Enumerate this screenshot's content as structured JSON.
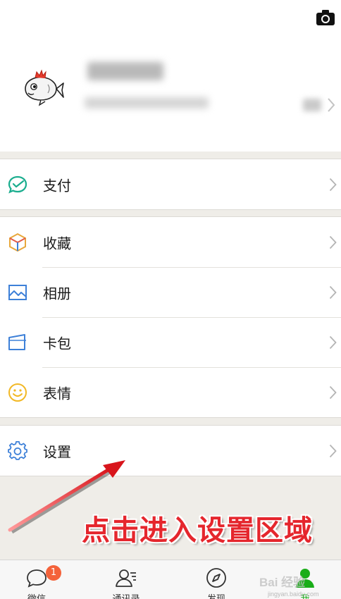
{
  "profile": {
    "camera_icon": "camera-icon",
    "avatar_icon": "fish-avatar"
  },
  "groups": [
    {
      "items": [
        {
          "label": "支付",
          "icon": "wallet-check-icon",
          "color": "#1aad8e"
        }
      ]
    },
    {
      "items": [
        {
          "label": "收藏",
          "icon": "cube-icon",
          "color": "#e8a83c"
        },
        {
          "label": "相册",
          "icon": "photo-album-icon",
          "color": "#3d80d8"
        },
        {
          "label": "卡包",
          "icon": "card-pack-icon",
          "color": "#3d80d8"
        },
        {
          "label": "表情",
          "icon": "smiley-icon",
          "color": "#f2b825"
        }
      ]
    },
    {
      "items": [
        {
          "label": "设置",
          "icon": "gear-icon",
          "color": "#3d80d8"
        }
      ]
    }
  ],
  "annotation": {
    "text": "点击进入设置区域",
    "color": "#e5262d"
  },
  "tabbar": {
    "tabs": [
      {
        "label": "微信",
        "icon": "chat-bubble-icon",
        "badge": "1"
      },
      {
        "label": "通讯录",
        "icon": "contacts-icon"
      },
      {
        "label": "发现",
        "icon": "compass-icon"
      },
      {
        "label": "我",
        "icon": "person-icon",
        "active": true
      }
    ]
  },
  "watermark": {
    "text": "Bai 经验",
    "sub": "jingyan.baidu.com"
  }
}
